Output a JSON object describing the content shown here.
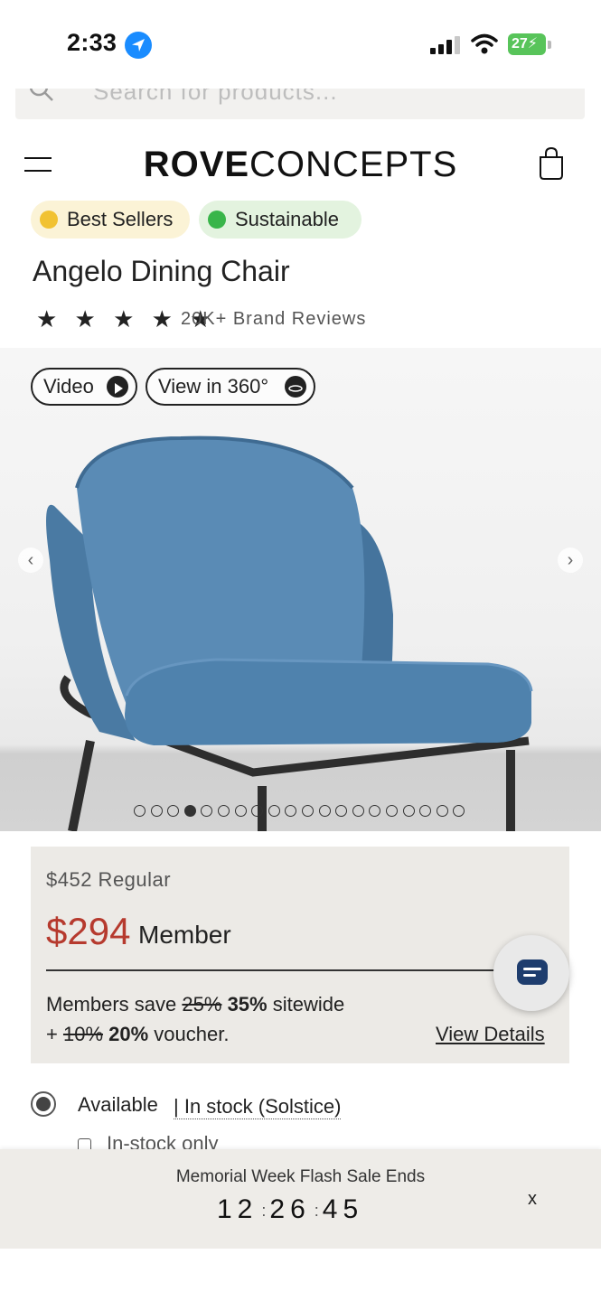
{
  "status_bar": {
    "time": "2:33",
    "battery": "27"
  },
  "search": {
    "placeholder": "Search for products..."
  },
  "header": {
    "brand_bold": "ROVE",
    "brand_light": "CONCEPTS"
  },
  "badges": [
    {
      "label": "Best Sellers",
      "icon": "medal-icon",
      "color": "#fbf3d6"
    },
    {
      "label": "Sustainable",
      "icon": "leaf-icon",
      "color": "#e3f3df"
    }
  ],
  "product": {
    "title": "Angelo Dining Chair",
    "stars": "★ ★ ★ ★ ★",
    "reviews": "20K+ Brand Reviews"
  },
  "media": {
    "video_label": "Video",
    "view360_label": "View in 360°"
  },
  "gallery": {
    "image_count": 20,
    "active_index": 3
  },
  "pricing": {
    "regular": "$452 Regular",
    "member_price": "$294",
    "member_label": "Member",
    "save_prefix": "Members save ",
    "save_old": "25%",
    "save_new": "35%",
    "save_suffix": " sitewide",
    "voucher_prefix": "+ ",
    "voucher_old": "10%",
    "voucher_new": "20%",
    "voucher_suffix": " voucher.",
    "view_details": "View Details",
    "accent_color": "#b63a2e"
  },
  "availability": {
    "label": "Available",
    "stock_link": "| In stock (Solstice)",
    "instock_only": "In-stock only"
  },
  "flash_sale": {
    "title": "Memorial Week Flash Sale Ends",
    "hours": "12",
    "minutes": "26",
    "seconds": "45",
    "close": "x"
  }
}
